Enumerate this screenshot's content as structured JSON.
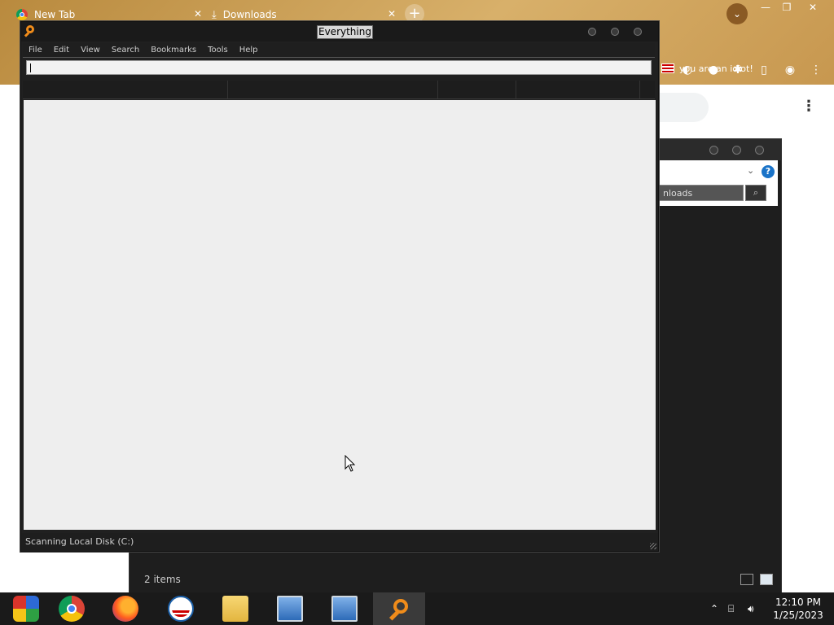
{
  "browser": {
    "tabs": [
      {
        "label": "New Tab",
        "close": "✕"
      },
      {
        "label": "Downloads",
        "close": "✕"
      }
    ],
    "new_tab": "+",
    "bookmark_label": "you are an idiot!"
  },
  "explorer": {
    "search_text": "nloads",
    "status": "2 items",
    "help": "?"
  },
  "everything": {
    "title": "Everything",
    "menu": [
      "File",
      "Edit",
      "View",
      "Search",
      "Bookmarks",
      "Tools",
      "Help"
    ],
    "search_value": "",
    "status": "Scanning Local Disk (C:)"
  },
  "taskbar": {
    "time": "12:10 PM",
    "date": "1/25/2023"
  }
}
